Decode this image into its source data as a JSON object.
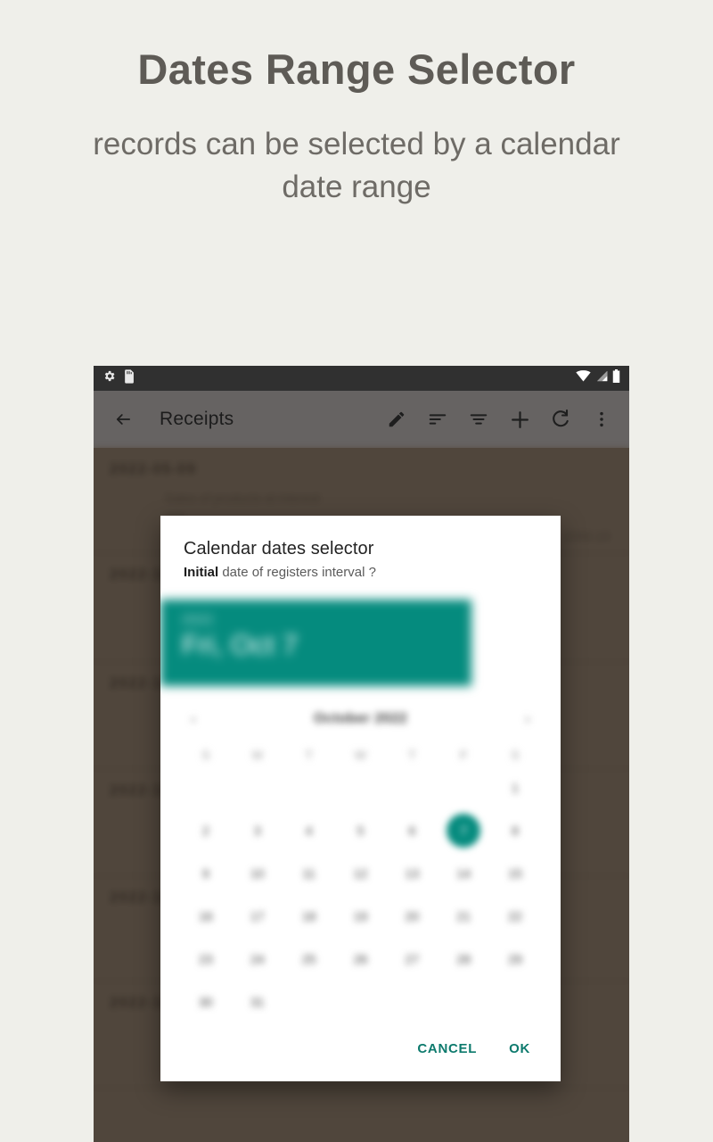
{
  "promo": {
    "title": "Dates Range Selector",
    "subtitle": "records can be selected by a calendar date range"
  },
  "colors": {
    "page_background": "#EFEFEA",
    "accent_teal": "#058B7E",
    "dim_overlay": "#5B5148",
    "appbar": "#666362",
    "statusbar": "#303030"
  },
  "statusbar": {
    "left_icons": [
      "settings-gear-icon",
      "sdcard-icon"
    ],
    "right_icons": [
      "wifi-icon",
      "cell-signal-icon",
      "battery-icon"
    ]
  },
  "appbar": {
    "back_label": "back-arrow",
    "title": "Receipts",
    "actions": [
      {
        "name": "edit",
        "icon": "pencil-icon"
      },
      {
        "name": "sort",
        "icon": "sort-icon"
      },
      {
        "name": "filter",
        "icon": "filter-icon"
      },
      {
        "name": "add",
        "icon": "plus-icon"
      },
      {
        "name": "refresh",
        "icon": "refresh-icon"
      },
      {
        "name": "overflow",
        "icon": "overflow-menu-icon"
      }
    ]
  },
  "record_list": [
    {
      "date": "2022-05-09",
      "description": "Sales of products at interest",
      "sub": "001",
      "amount": "2050.10"
    },
    {
      "date": "2022-10",
      "description": "",
      "sub": "",
      "amount": ""
    },
    {
      "date": "2022-10",
      "description": "",
      "sub": "",
      "amount": ""
    },
    {
      "date": "2022-10",
      "description": "",
      "sub": "",
      "amount": ""
    },
    {
      "date": "2022-10",
      "description": "",
      "sub": "",
      "amount": ""
    },
    {
      "date": "2022-10",
      "description": "",
      "sub": "",
      "amount": ""
    }
  ],
  "dialog": {
    "title": "Calendar dates selector",
    "subtitle_bold": "Initial",
    "subtitle_rest": " date of registers interval ?",
    "date_header": {
      "year": "2022",
      "day_line": "Fri, Oct 7"
    },
    "calendar": {
      "prev_arrow": "‹",
      "next_arrow": "›",
      "month_label": "October 2022",
      "weekdays": [
        "S",
        "M",
        "T",
        "W",
        "T",
        "F",
        "S"
      ],
      "leading_blanks": 6,
      "days": [
        1,
        2,
        3,
        4,
        5,
        6,
        7,
        8,
        9,
        10,
        11,
        12,
        13,
        14,
        15,
        16,
        17,
        18,
        19,
        20,
        21,
        22,
        23,
        24,
        25,
        26,
        27,
        28,
        29,
        30,
        31
      ],
      "selected_day": 7
    },
    "cancel_label": "CANCEL",
    "ok_label": "OK"
  }
}
